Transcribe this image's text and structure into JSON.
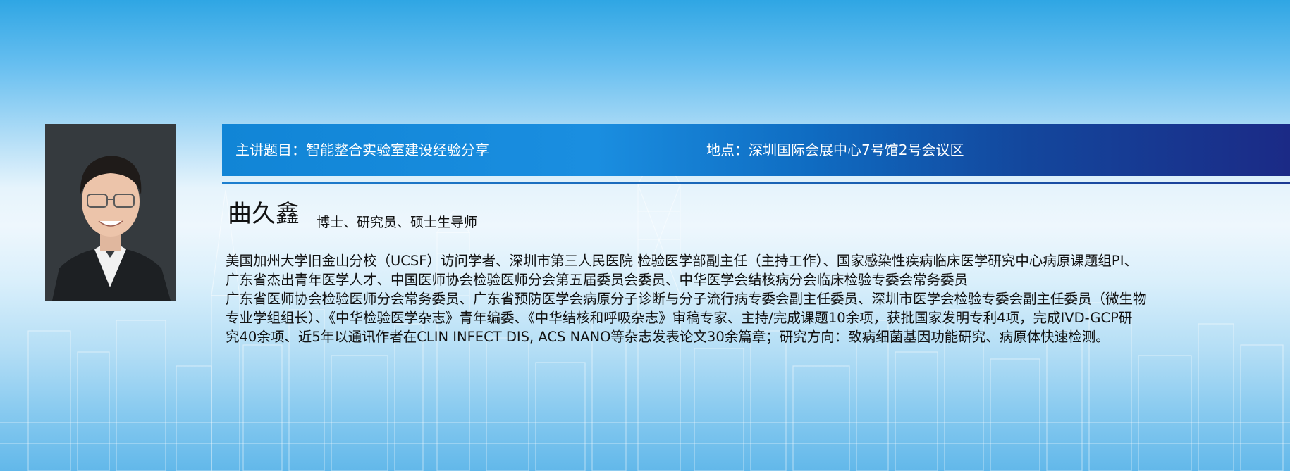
{
  "banner": {
    "topic_label": "主讲题目：智能整合实验室建设经验分享",
    "venue_label": "地点：深圳国际会展中心7号馆2号会议区"
  },
  "speaker": {
    "name": "曲久鑫",
    "titles": "博士、研究员、硕士生导师",
    "bio_lines": [
      "美国加州大学旧金山分校（UCSF）访问学者、深圳市第三人民医院 检验医学部副主任（主持工作）、国家感染性疾病临床医学研究中心病原课题组PI、",
      "广东省杰出青年医学人才、中国医师协会检验医师分会第五届委员会委员、中华医学会结核病分会临床检验专委会常务委员",
      "广东省医师协会检验医师分会常务委员、广东省预防医学会病原分子诊断与分子流行病专委会副主任委员、深圳市医学会检验专委会副主任委员（微生物",
      "专业学组组长）、《中华检验医学杂志》青年编委、《中华结核和呼吸杂志》审稿专家、主持/完成课题10余项，获批国家发明专利4项，完成IVD-GCP研",
      "究40余项、近5年以通讯作者在CLIN INFECT DIS, ACS NANO等杂志发表论文30余篇章；研究方向：致病细菌基因功能研究、病原体快速检测。"
    ]
  },
  "colors": {
    "banner_start": "#1185d6",
    "banner_end": "#1b2a86",
    "background_top": "#2fa6e4",
    "background_bottom": "#62b8ea"
  }
}
